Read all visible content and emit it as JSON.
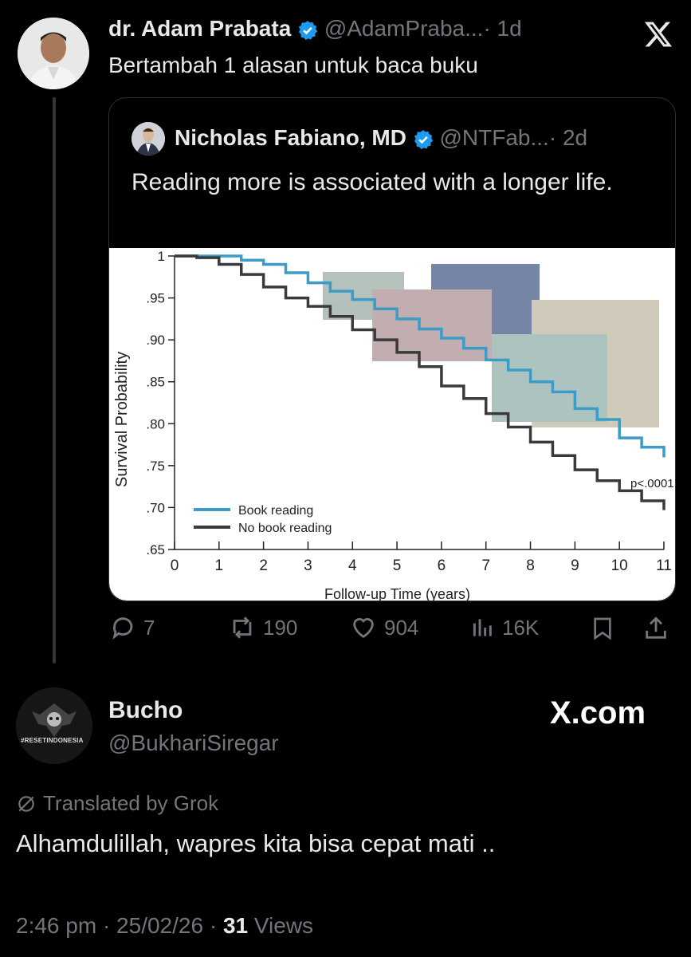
{
  "main_post": {
    "author_name": "dr. Adam Prabata",
    "handle": "@AdamPraba...",
    "time": "· 1d",
    "text": "Bertambah 1 alasan untuk baca buku"
  },
  "quoted_post": {
    "author_name": "Nicholas Fabiano, MD",
    "handle": "@NTFab...",
    "time": "· 2d",
    "text": "Reading more is associated with a longer life."
  },
  "actions": {
    "replies": "7",
    "reposts": "190",
    "likes": "904",
    "views": "16K"
  },
  "reply_post": {
    "author_name": "Bucho",
    "handle": "@BukhariSiregar",
    "avatar_text": "#RESETINDONESIA",
    "watermark": "X.com",
    "translated_label": "Translated by Grok",
    "text": "Alhamdulillah, wapres kita bisa cepat mati ..",
    "timestamp": "2:46 pm · 25/02/26 ·",
    "views_count": "31",
    "views_label": "Views"
  },
  "colors": {
    "background": "#000000",
    "text": "#e7e9ea",
    "muted": "#71767b",
    "verified": "#1d9bf0",
    "book_reading_line": "#3a9cc7",
    "no_book_line": "#3a3a3a"
  },
  "chart_data": {
    "type": "line",
    "ylabel": "Survival Probability",
    "xlabel": "Follow-up Time (years)",
    "ylim": [
      0.65,
      1.0
    ],
    "xlim": [
      0,
      11
    ],
    "x_ticks": [
      "0",
      "1",
      "2",
      "3",
      "4",
      "5",
      "6",
      "7",
      "8",
      "9",
      "10",
      "11"
    ],
    "y_ticks": [
      "1",
      ".95",
      ".90",
      ".85",
      ".80",
      ".75",
      ".70",
      ".65"
    ],
    "annotation": "p<.0001",
    "legend_position": "bottom-left",
    "grid": false,
    "series": [
      {
        "name": "Book reading",
        "x": [
          0,
          0.5,
          1,
          1.5,
          2,
          2.5,
          3,
          3.5,
          4,
          4.5,
          5,
          5.5,
          6,
          6.5,
          7,
          7.5,
          8,
          8.5,
          9,
          9.5,
          10,
          10.5,
          11
        ],
        "y": [
          1.0,
          1.0,
          1.0,
          0.995,
          0.99,
          0.98,
          0.968,
          0.958,
          0.948,
          0.937,
          0.925,
          0.913,
          0.902,
          0.89,
          0.876,
          0.864,
          0.85,
          0.838,
          0.818,
          0.805,
          0.783,
          0.772,
          0.76
        ]
      },
      {
        "name": "No book reading",
        "x": [
          0,
          0.5,
          1,
          1.5,
          2,
          2.5,
          3,
          3.5,
          4,
          4.5,
          5,
          5.5,
          6,
          6.5,
          7,
          7.5,
          8,
          8.5,
          9,
          9.5,
          10,
          10.5,
          11
        ],
        "y": [
          1.0,
          0.998,
          0.99,
          0.978,
          0.963,
          0.95,
          0.94,
          0.928,
          0.912,
          0.9,
          0.885,
          0.868,
          0.845,
          0.83,
          0.812,
          0.796,
          0.778,
          0.762,
          0.745,
          0.732,
          0.72,
          0.708,
          0.697
        ]
      }
    ]
  }
}
